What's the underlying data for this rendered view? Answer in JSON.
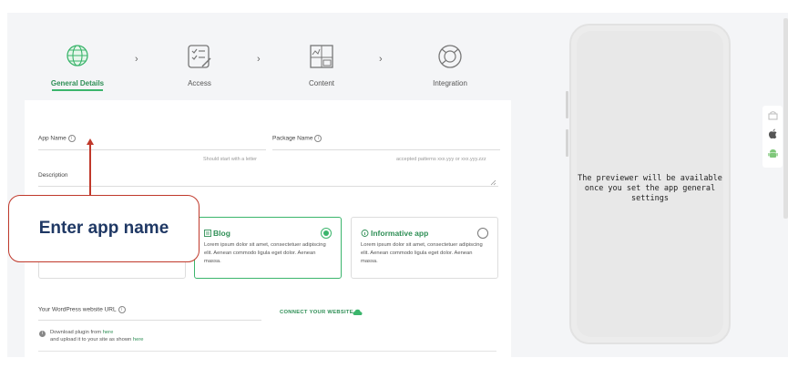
{
  "stepper": {
    "steps": [
      {
        "label": "General Details",
        "icon": "globe-icon",
        "active": true
      },
      {
        "label": "Access",
        "icon": "checklist-icon",
        "active": false
      },
      {
        "label": "Content",
        "icon": "content-layout-icon",
        "active": false
      },
      {
        "label": "Integration",
        "icon": "integration-ring-icon",
        "active": false
      }
    ],
    "separator": "›"
  },
  "form": {
    "app_name_label": "App Name",
    "package_name_label": "Package Name",
    "app_name_hint": "Should start with a letter",
    "package_hint": "accepted patterns xxx.yyy or xxx.yyy.zzz",
    "description_label": "Description",
    "app_types": [
      {
        "title": "Blog",
        "icon": "document-icon",
        "description": "Lorem ipsum dolor sit amet, consectetuer adipiscing elit. Aenean commodo ligula eget dolor. Aenean massa.",
        "selected": true
      },
      {
        "title": "Informative app",
        "icon": "info-app-icon",
        "description": "Lorem ipsum dolor sit amet, consectetuer adipiscing elit. Aenean commodo ligula eget dolor. Aenean massa.",
        "selected": false
      }
    ],
    "wp_url_label": "Your WordPress website URL",
    "connect_label": "CONNECT YOUR WEBSITE",
    "download_prefix": "Download plugin from",
    "download_link": "here",
    "upload_prefix": "and upload it to your site as shown",
    "upload_link": "here"
  },
  "callout": {
    "text": "Enter app name",
    "border_color": "#c0392b",
    "text_color": "#1f3864"
  },
  "preview": {
    "message": "The previewer will be available once you set the app general settings"
  },
  "platforms": [
    "store-icon",
    "apple-icon",
    "android-icon"
  ],
  "colors": {
    "accent": "#3bb56c",
    "accent_dark": "#2f8f56"
  }
}
